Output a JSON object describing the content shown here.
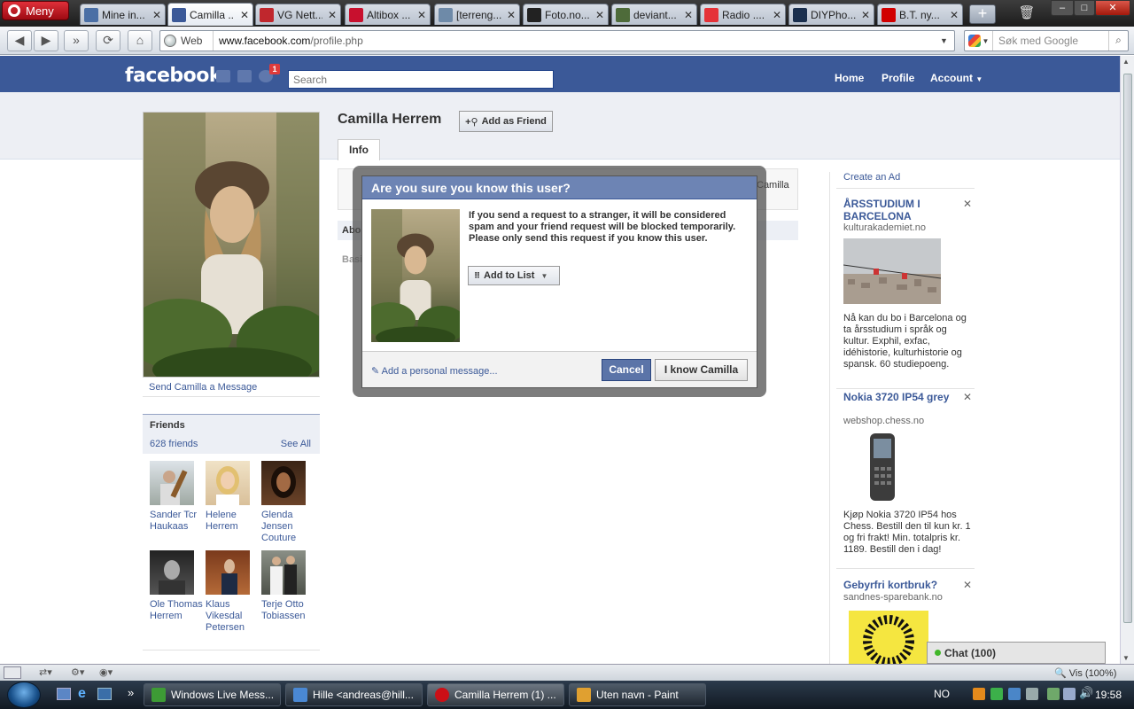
{
  "browser": {
    "menu_label": "Meny",
    "tabs": [
      {
        "label": "Mine in...",
        "color": "#4a6fa5",
        "active": false
      },
      {
        "label": "Camilla ...",
        "color": "#3b5998",
        "active": true
      },
      {
        "label": "VG Nett...",
        "color": "#c0272d",
        "active": false
      },
      {
        "label": "Altibox ...",
        "color": "#c8102e",
        "active": false
      },
      {
        "label": "[terreng...",
        "color": "#6e8aa8",
        "active": false
      },
      {
        "label": "Foto.no...",
        "color": "#222222",
        "active": false
      },
      {
        "label": "deviant...",
        "color": "#4e6b3a",
        "active": false
      },
      {
        "label": "Radio ....",
        "color": "#e53238",
        "active": false
      },
      {
        "label": "DIYPho...",
        "color": "#1a2f4e",
        "active": false
      },
      {
        "label": "B.T. ny...",
        "color": "#d10000",
        "active": false
      }
    ],
    "web_label": "Web",
    "url_domain": "www.facebook.com",
    "url_path": "/profile.php",
    "search_placeholder": "Søk med Google"
  },
  "facebook": {
    "logo": "facebook",
    "notification_count": "1",
    "search_placeholder": "Search",
    "nav": {
      "home": "Home",
      "profile": "Profile",
      "account": "Account"
    },
    "profile": {
      "name": "Camilla Herrem",
      "add_friend": "Add as Friend",
      "tab_info": "Info",
      "send_message": "Send Camilla a Message",
      "under_about": "Abo",
      "under_basic": "Basi",
      "under_camilla": "Camilla"
    },
    "friends": {
      "title": "Friends",
      "count": "628 friends",
      "see_all": "See All",
      "list": [
        {
          "name": "Sander Tcr Haukaas"
        },
        {
          "name": "Helene Herrem"
        },
        {
          "name": "Glenda Jensen Couture"
        },
        {
          "name": "Ole Thomas Herrem"
        },
        {
          "name": "Klaus Vikesdal Petersen"
        },
        {
          "name": "Terje Otto Tobiassen"
        }
      ]
    },
    "ads": {
      "create_ad": "Create an Ad",
      "items": [
        {
          "title": "ÅRSSTUDIUM I BARCELONA",
          "url": "kulturakademiet.no",
          "body": "Nå kan du bo i Barcelona og ta årsstudium i språk og kultur. Exphil, exfac, idéhistorie, kulturhistorie og spansk. 60 studiepoeng."
        },
        {
          "title": "Nokia 3720 IP54 grey",
          "url": "webshop.chess.no",
          "body": "Kjøp Nokia 3720 IP54 hos Chess. Bestill den til kun kr. 1 og fri frakt! Min. totalpris kr. 1189. Bestill den i dag!"
        },
        {
          "title": "Gebyrfri kortbruk?",
          "url": "sandnes-sparebank.no",
          "body": ""
        }
      ]
    },
    "chat_label": "Chat (100)"
  },
  "dialog": {
    "title": "Are you sure you know this user?",
    "message": "If you send a request to a stranger, it will be considered spam and your friend request will be blocked temporarily. Please only send this request if you know this user.",
    "add_to_list": "Add to List",
    "personal_message": "Add a personal message...",
    "cancel": "Cancel",
    "confirm": "I know Camilla"
  },
  "statusbar": {
    "zoom": "Vis (100%)"
  },
  "taskbar": {
    "items": [
      {
        "label": "Windows Live Mess...",
        "color": "#3d9b35"
      },
      {
        "label": "Hille <andreas@hill...",
        "color": "#4a88d4"
      },
      {
        "label": "Camilla Herrem (1) ...",
        "color": "#cc0f16"
      },
      {
        "label": "Uten navn - Paint",
        "color": "#e0a030"
      }
    ],
    "lang": "NO",
    "clock": "19:58"
  }
}
